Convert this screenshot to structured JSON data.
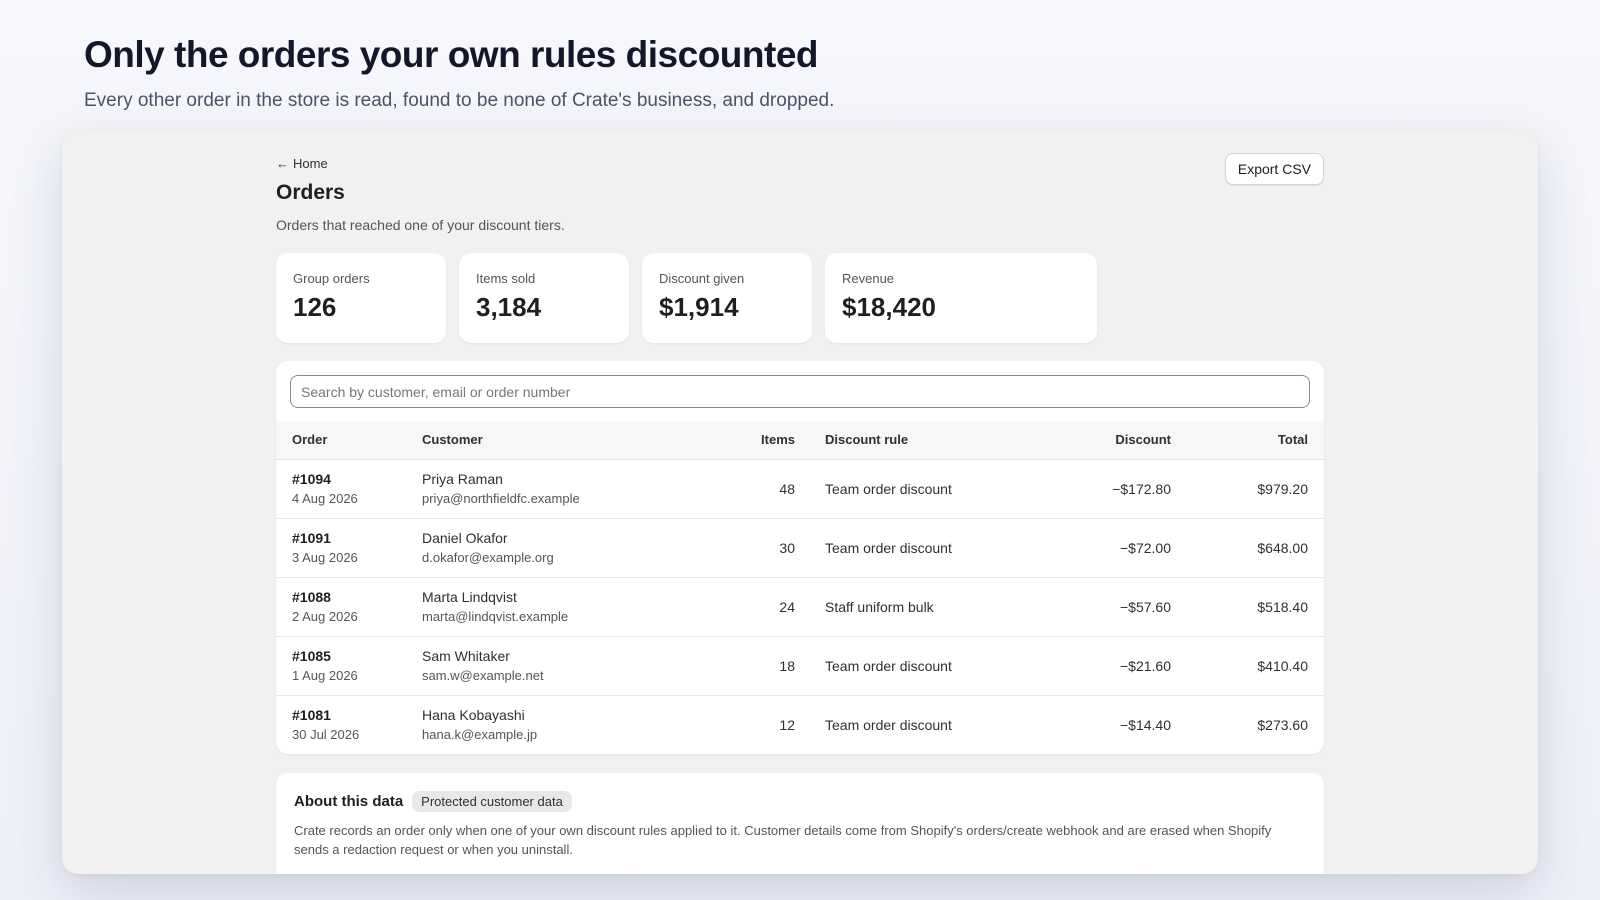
{
  "hero": {
    "title": "Only the orders your own rules discounted",
    "subtitle": "Every other order in the store is read, found to be none of Crate's business, and dropped."
  },
  "page": {
    "back_label": "Home",
    "back_icon": "arrow-left-icon",
    "title": "Orders",
    "description": "Orders that reached one of your discount tiers.",
    "export_label": "Export CSV"
  },
  "stats": [
    {
      "label": "Group orders",
      "value": "126"
    },
    {
      "label": "Items sold",
      "value": "3,184"
    },
    {
      "label": "Discount given",
      "value": "$1,914"
    },
    {
      "label": "Revenue",
      "value": "$18,420"
    }
  ],
  "search": {
    "placeholder": "Search by customer, email or order number",
    "value": ""
  },
  "table": {
    "headers": {
      "order": "Order",
      "customer": "Customer",
      "items": "Items",
      "rule": "Discount rule",
      "discount": "Discount",
      "total": "Total"
    },
    "rows": [
      {
        "order": "#1094",
        "date": "4 Aug 2026",
        "name": "Priya Raman",
        "email": "priya@northfieldfc.example",
        "items": "48",
        "rule": "Team order discount",
        "discount": "−$172.80",
        "total": "$979.20"
      },
      {
        "order": "#1091",
        "date": "3 Aug 2026",
        "name": "Daniel Okafor",
        "email": "d.okafor@example.org",
        "items": "30",
        "rule": "Team order discount",
        "discount": "−$72.00",
        "total": "$648.00"
      },
      {
        "order": "#1088",
        "date": "2 Aug 2026",
        "name": "Marta Lindqvist",
        "email": "marta@lindqvist.example",
        "items": "24",
        "rule": "Staff uniform bulk",
        "discount": "−$57.60",
        "total": "$518.40"
      },
      {
        "order": "#1085",
        "date": "1 Aug 2026",
        "name": "Sam Whitaker",
        "email": "sam.w@example.net",
        "items": "18",
        "rule": "Team order discount",
        "discount": "−$21.60",
        "total": "$410.40"
      },
      {
        "order": "#1081",
        "date": "30 Jul 2026",
        "name": "Hana Kobayashi",
        "email": "hana.k@example.jp",
        "items": "12",
        "rule": "Team order discount",
        "discount": "−$14.40",
        "total": "$273.60"
      }
    ]
  },
  "about": {
    "title": "About this data",
    "badge": "Protected customer data",
    "text": "Crate records an order only when one of your own discount rules applied to it. Customer details come from Shopify's orders/create webhook and are erased when Shopify sends a redaction request or when you uninstall."
  }
}
